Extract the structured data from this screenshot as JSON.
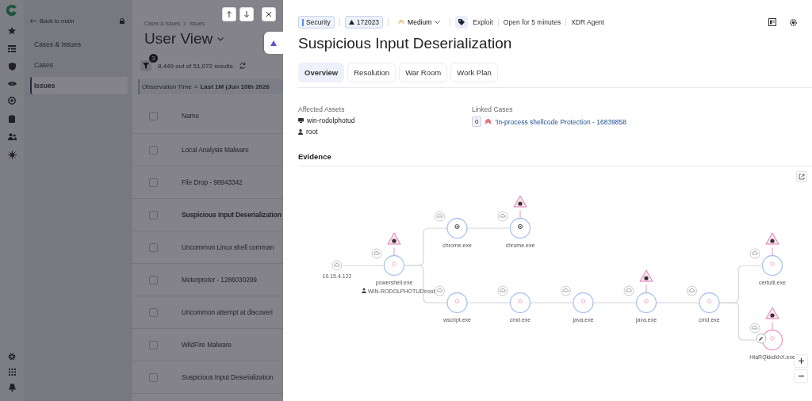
{
  "nav": {
    "back": "Back to main",
    "items": [
      {
        "label": "Cases & Issues",
        "selected": false
      },
      {
        "label": "Cases",
        "selected": false
      },
      {
        "label": "Issues",
        "selected": true
      }
    ]
  },
  "list": {
    "breadcrumb": [
      "Cases & Issues",
      "Issues"
    ],
    "title": "User View",
    "filter_count": "3",
    "results": "8,449 out of 51,072 results",
    "filter_chip": {
      "field": "Observation Time",
      "operator": "=",
      "value": "Last 1M (Jun 10th 2026"
    },
    "columns": [
      "Name"
    ],
    "select_all_checked": false,
    "rows": [
      {
        "name": "Local Analysis Malware",
        "selected": false,
        "checked": false
      },
      {
        "name": "File Drop - 98943342",
        "selected": false,
        "checked": false
      },
      {
        "name": "Suspicious Input Deserialization",
        "selected": true,
        "checked": false
      },
      {
        "name": "Uncommon Linux shell comman",
        "selected": false,
        "checked": false
      },
      {
        "name": "Meterpreter - 1286030299",
        "selected": false,
        "checked": false
      },
      {
        "name": "Uncommon attempt at discoveri",
        "selected": false,
        "checked": false
      },
      {
        "name": "WildFire Malware",
        "selected": false,
        "checked": false
      },
      {
        "name": "Suspicious Input Deserialization",
        "selected": false,
        "checked": false
      }
    ]
  },
  "issue": {
    "category": "Security",
    "id": "172023",
    "severity": "Medium",
    "meta": [
      "Exploit",
      "Open for 5 minutes",
      "XDR Agent"
    ],
    "title": "Suspicious Input Deserialization",
    "tabs": [
      {
        "label": "Overview",
        "selected": true
      },
      {
        "label": "Resolution",
        "selected": false
      },
      {
        "label": "War Room",
        "selected": false
      },
      {
        "label": "Work Plan",
        "selected": false
      }
    ],
    "affected_assets": {
      "label": "Affected Assets",
      "items": [
        {
          "kind": "host",
          "value": "win-rodolphotud"
        },
        {
          "kind": "user",
          "value": "root"
        }
      ]
    },
    "linked_cases": {
      "label": "Linked Cases",
      "count": "0",
      "case": "'In-process shellcode Protection - 16839858"
    },
    "evidence": {
      "title": "Evidence",
      "graph": {
        "kind": "ip",
        "label": "10.15.4.122",
        "alert": false,
        "flagged": false,
        "children": [
          {
            "kind": "process",
            "label": "powershell.exe",
            "user": "WIN-RODOLPHOTUD\\root",
            "alert": true,
            "flagged": false,
            "children": [
              {
                "kind": "browser",
                "label": "chrome.exe",
                "alert": false,
                "flagged": false,
                "children": [
                  {
                    "kind": "browser",
                    "label": "chrome.exe",
                    "alert": true,
                    "flagged": false
                  }
                ]
              },
              {
                "kind": "process",
                "label": "wscript.exe",
                "alert": false,
                "flagged": false,
                "children": [
                  {
                    "kind": "process",
                    "label": "cmd.exe",
                    "alert": false,
                    "flagged": false,
                    "children": [
                      {
                        "kind": "process",
                        "label": "java.exe",
                        "alert": false,
                        "flagged": false,
                        "children": [
                          {
                            "kind": "process",
                            "label": "java.exe",
                            "alert": true,
                            "flagged": false,
                            "children": [
                              {
                                "kind": "process",
                                "label": "cmd.exe",
                                "alert": false,
                                "flagged": false,
                                "children": [
                                  {
                                    "kind": "process",
                                    "label": "certutil.exe",
                                    "alert": true,
                                    "flagged": false
                                  },
                                  {
                                    "kind": "process",
                                    "label": "HtaRQkkdkhX.exe",
                                    "alert": true,
                                    "flagged": true
                                  }
                                ]
                              }
                            ]
                          }
                        ]
                      }
                    ]
                  }
                ]
              }
            ]
          }
        ]
      }
    }
  }
}
